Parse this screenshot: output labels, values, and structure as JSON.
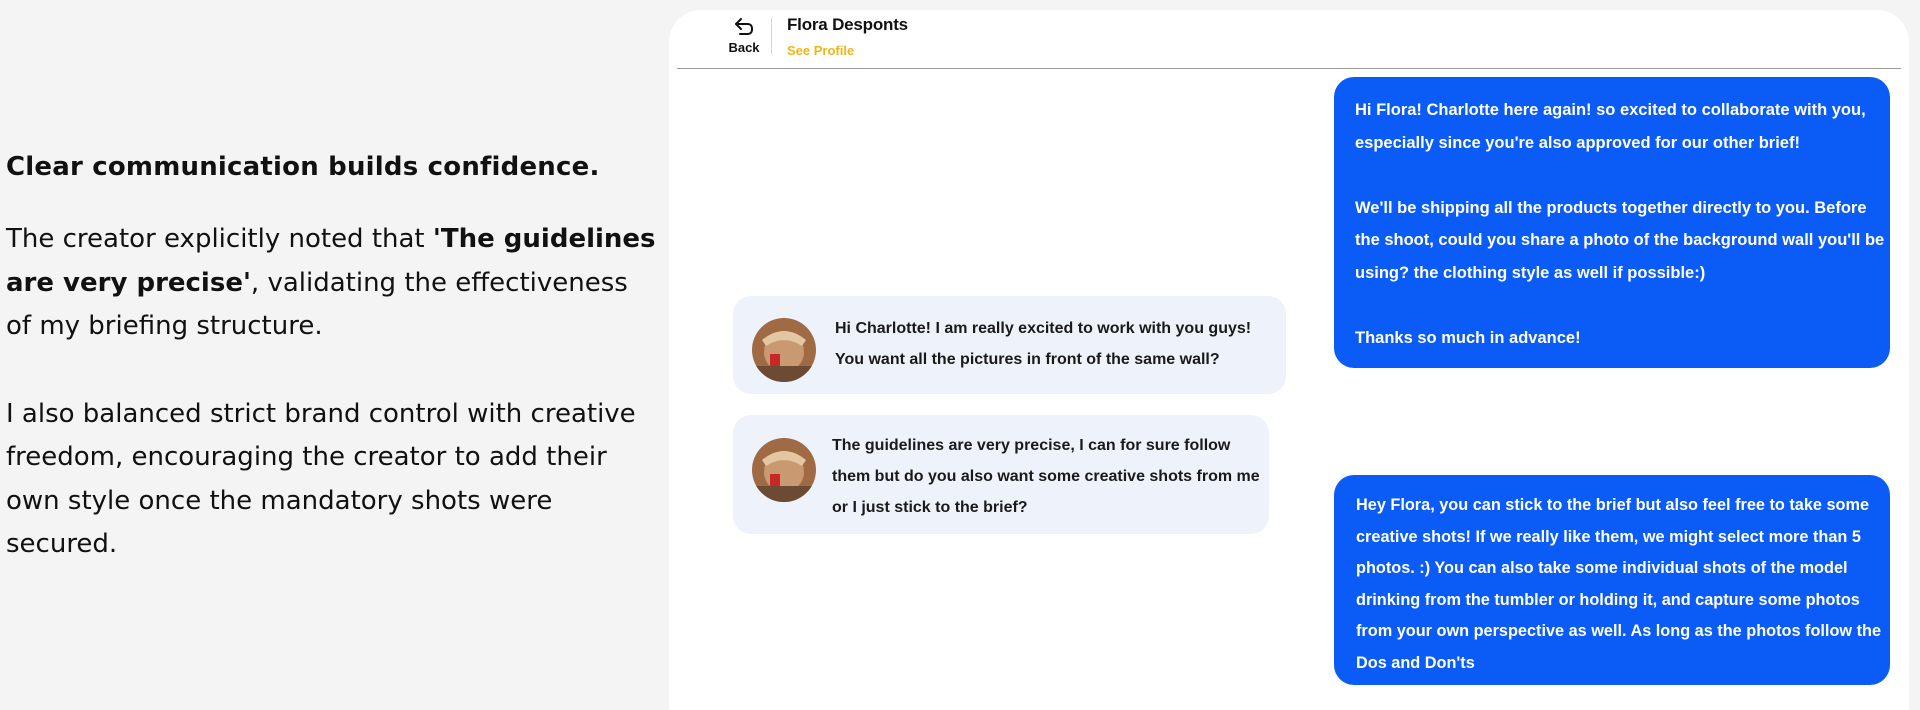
{
  "caption": {
    "heading": "Clear communication builds confidence.",
    "p1_prefix": "The creator explicitly noted that ",
    "p1_bold": "'The guidelines are very precise'",
    "p1_suffix": ", validating the effectiveness of my briefing structure.",
    "p2": "I also balanced strict brand control with creative freedom, encouraging the creator to add their own style once the mandatory shots were secured."
  },
  "chat": {
    "header": {
      "back_label": "Back",
      "back_icon": "back-arrow-icon",
      "contact_name": "Flora Desponts",
      "see_profile": "See Profile"
    },
    "messages": [
      {
        "direction": "outgoing",
        "text": "Hi Flora! Charlotte here again! so excited to collaborate with you, especially since you're also approved for our other brief!\n\nWe'll be shipping all the products together directly to you. Before the shoot, could you share a photo of the background wall you'll be using? the clothing style as well if possible:)\n\nThanks so much in advance!"
      },
      {
        "direction": "incoming",
        "text": "Hi Charlotte! I am really excited to work with you guys!\nYou want all the pictures in front of the same wall?"
      },
      {
        "direction": "incoming",
        "text": "The guidelines are very precise, I can for sure follow them but do you also want some creative shots from me or I just stick to the brief?"
      },
      {
        "direction": "outgoing",
        "text": "Hey Flora, you can stick to the brief but also feel free to take some creative shots! If we really like them, we might select more than 5 photos. :) You can also take some individual shots of the model drinking from the tumbler or holding it, and capture some photos from your own perspective as well. As long as the photos follow the Dos and Don'ts"
      }
    ],
    "colors": {
      "outgoing_bubble": "#0b5cf6",
      "incoming_bubble": "#eef3fb",
      "see_profile": "#f2b514"
    }
  }
}
